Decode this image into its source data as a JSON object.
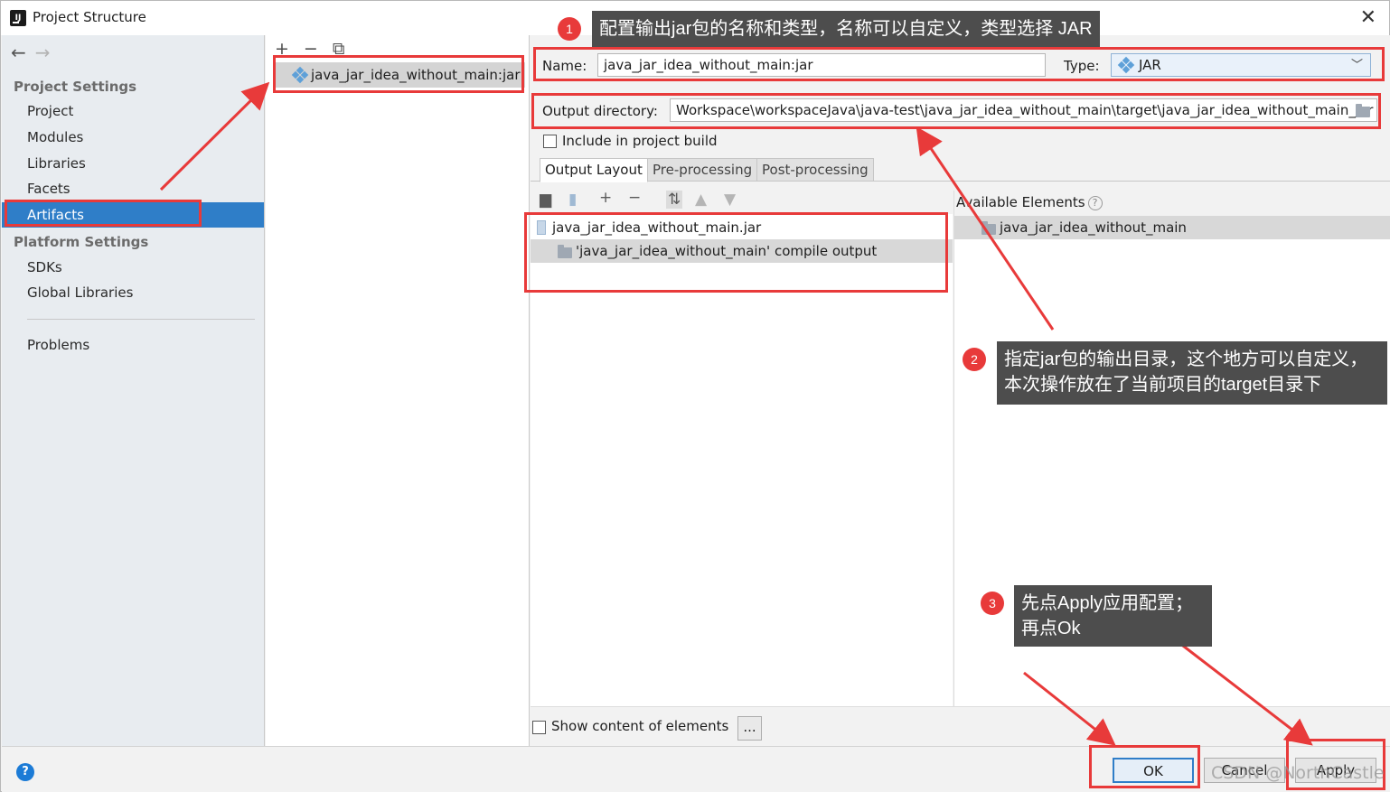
{
  "window": {
    "title": "Project Structure"
  },
  "sidebar": {
    "project_settings_heading": "Project Settings",
    "project_items": [
      "Project",
      "Modules",
      "Libraries",
      "Facets",
      "Artifacts"
    ],
    "selected_item": "Artifacts",
    "platform_settings_heading": "Platform Settings",
    "platform_items": [
      "SDKs",
      "Global Libraries"
    ],
    "problems_label": "Problems"
  },
  "artifacts": {
    "toolbar": {
      "add": "+",
      "remove": "−",
      "copy": "⧉"
    },
    "items": [
      "java_jar_idea_without_main:jar"
    ]
  },
  "config": {
    "name_label": "Name:",
    "name_value": "java_jar_idea_without_main:jar",
    "type_label": "Type:",
    "type_value": "JAR",
    "output_dir_label": "Output directory:",
    "output_dir_value": "Workspace\\workspaceJava\\java-test\\java_jar_idea_without_main\\target\\java_jar_idea_without_main_jar",
    "include_label": "Include in project build",
    "include_checked": false
  },
  "tabs": [
    "Output Layout",
    "Pre-processing",
    "Post-processing"
  ],
  "output_layout": {
    "tree": [
      "java_jar_idea_without_main.jar",
      "'java_jar_idea_without_main' compile output"
    ]
  },
  "available": {
    "heading": "Available Elements",
    "items": [
      "java_jar_idea_without_main"
    ]
  },
  "bottom": {
    "show_content_label": "Show content of elements",
    "show_content_checked": false,
    "dots_label": "..."
  },
  "footer": {
    "help": "?",
    "ok": "OK",
    "cancel": "Cancel",
    "apply": "Apply"
  },
  "annotations": {
    "badges": [
      "1",
      "2",
      "3"
    ],
    "callout1": "配置输出jar包的名称和类型，名称可以自定义，类型选择 JAR",
    "callout2_line1": "指定jar包的输出目录，这个地方可以自定义，",
    "callout2_line2": "本次操作放在了当前项目的target目录下",
    "callout3_line1": "先点Apply应用配置；",
    "callout3_line2": "再点Ok",
    "color": "#e83a3a"
  },
  "watermark": "CSDN @NorthCastle",
  "colors": {
    "selection": "#2f7ec8",
    "annotation_red": "#e83a3a",
    "callout_bg": "#4d4d4d"
  }
}
